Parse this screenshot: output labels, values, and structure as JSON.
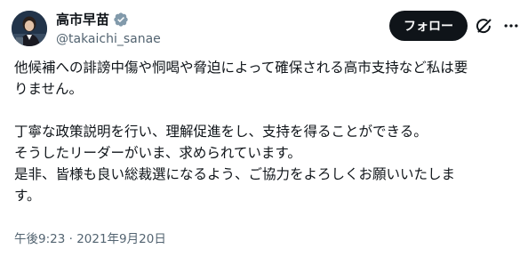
{
  "author": {
    "display_name": "高市早苗",
    "handle": "@takaichi_sanae",
    "verified_icon": "verified-badge-icon",
    "avatar_icon": "avatar"
  },
  "header": {
    "follow_label": "フォロー",
    "grok_icon": "grok-icon",
    "more_icon": "more-dots-icon"
  },
  "tweet": {
    "lines": [
      "他候補への誹謗中傷や恫喝や脅迫によって確保される高市支持など私は要",
      "りません。",
      "",
      "丁寧な政策説明を行い、理解促進をし、支持を得ることができる。",
      "そうしたリーダーがいま、求められています。",
      "是非、皆様も良い総裁選になるよう、ご協力をよろしくお願いいたしま",
      "す。"
    ]
  },
  "meta": {
    "time": "午後9:23",
    "separator": " · ",
    "date": "2021年9月20日"
  },
  "colors": {
    "text": "#0f1419",
    "secondary": "#536471",
    "verified": "#829aab",
    "follow_bg": "#0f1419"
  }
}
